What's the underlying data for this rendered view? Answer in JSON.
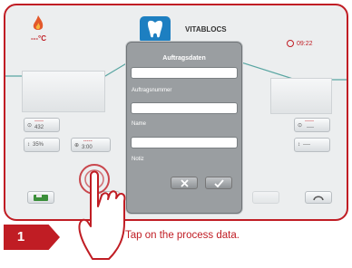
{
  "header": {
    "temperature": "---°C",
    "program_name": "VITABLOCS",
    "time": "09:22"
  },
  "params_left": [
    {
      "symbol": "⊙",
      "top": "-----",
      "bottom": "432"
    },
    {
      "symbol": "↕",
      "top": "",
      "bottom": "35%"
    },
    {
      "symbol": "⊕",
      "top": "-----",
      "bottom": "3:00"
    }
  ],
  "params_right": [
    {
      "symbol": "⊙",
      "top": "-----",
      "bottom": "----"
    },
    {
      "symbol": "↕",
      "top": "",
      "bottom": "----"
    }
  ],
  "hover_ctrl": {
    "symbol": "↕",
    "value": "----"
  },
  "dialog": {
    "title": "Auftragsdaten",
    "fields": [
      {
        "label": "",
        "value": ""
      },
      {
        "label": "Auftragsnummer",
        "value": ""
      },
      {
        "label": "Name",
        "value": ""
      },
      {
        "label": "Notiz",
        "value": ""
      }
    ],
    "cancel_icon": "close-icon",
    "confirm_icon": "checkmark-icon"
  },
  "toolbar_icons": [
    "tooth-program-icon",
    "process-data-icon",
    "night-mode-icon",
    "save-icon",
    "blank-icon",
    "back-icon"
  ],
  "instruction": {
    "step_number": "1",
    "text": "Tap on the process data."
  },
  "colors": {
    "accent": "#c01d24",
    "logo_blue": "#1d7fc1",
    "wave": "#5aa6a2"
  }
}
